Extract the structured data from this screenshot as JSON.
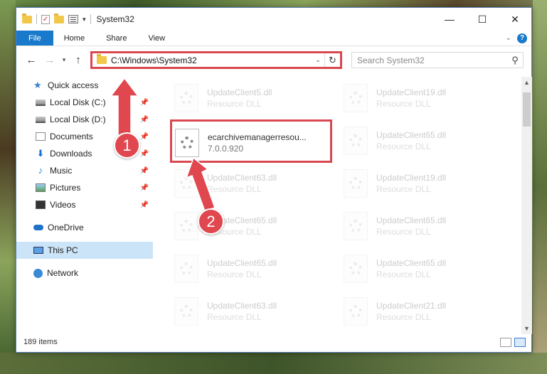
{
  "window": {
    "title": "System32"
  },
  "ribbon": {
    "tabs": [
      "File",
      "Home",
      "Share",
      "View"
    ]
  },
  "address": {
    "path": "C:\\Windows\\System32"
  },
  "search": {
    "placeholder": "Search System32"
  },
  "sidebar": {
    "items": [
      {
        "label": "Quick access",
        "icon": "star-icon"
      },
      {
        "label": "Local Disk (C:)",
        "icon": "disk-icon",
        "pinned": true
      },
      {
        "label": "Local Disk (D:)",
        "icon": "disk-icon",
        "pinned": true
      },
      {
        "label": "Documents",
        "icon": "documents-icon",
        "pinned": true
      },
      {
        "label": "Downloads",
        "icon": "download-icon",
        "pinned": true
      },
      {
        "label": "Music",
        "icon": "music-icon",
        "pinned": true
      },
      {
        "label": "Pictures",
        "icon": "pictures-icon",
        "pinned": true
      },
      {
        "label": "Videos",
        "icon": "videos-icon",
        "pinned": true
      },
      {
        "label": "OneDrive",
        "icon": "onedrive-icon"
      },
      {
        "label": "This PC",
        "icon": "pc-icon",
        "selected": true
      },
      {
        "label": "Network",
        "icon": "network-icon"
      }
    ]
  },
  "files": {
    "highlighted": {
      "name": "ecarchivemanagerresou...",
      "version": "7.0.0.920"
    },
    "background_left": [
      {
        "name": "UpdateClient5.dll",
        "type": "Resource DLL"
      },
      {
        "name": "UpdateClient63.dll",
        "type": "Resource DLL"
      },
      {
        "name": "UpdateClient65.dll",
        "type": "Resource DLL"
      },
      {
        "name": "UpdateClient65.dll",
        "type": "Resource DLL"
      },
      {
        "name": "UpdateClient63.dll",
        "type": "Resource DLL"
      }
    ],
    "background_right": [
      {
        "name": "UpdateClient19.dll",
        "type": "Resource DLL"
      },
      {
        "name": "UpdateClient65.dll",
        "type": "Resource DLL"
      },
      {
        "name": "UpdateClient19.dll",
        "type": "Resource DLL"
      },
      {
        "name": "UpdateClient65.dll",
        "type": "Resource DLL"
      },
      {
        "name": "UpdateClient65.dll",
        "type": "Resource DLL"
      },
      {
        "name": "UpdateClient21.dll",
        "type": "Resource DLL"
      }
    ]
  },
  "status": {
    "count": "189 items"
  },
  "annotations": {
    "step1": "1",
    "step2": "2",
    "color": "#e0474f"
  }
}
